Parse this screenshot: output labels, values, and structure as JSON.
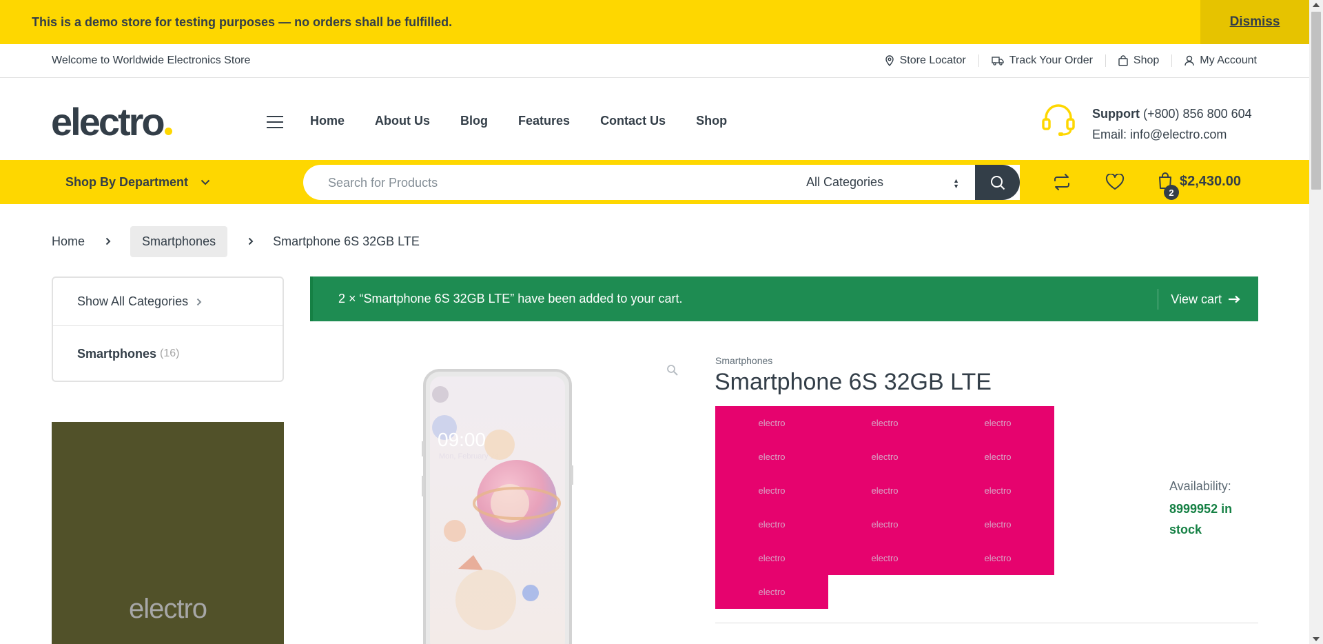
{
  "notice": {
    "text": "This is a demo store for testing purposes — no orders shall be fulfilled.",
    "dismiss_label": "Dismiss"
  },
  "topbar": {
    "welcome": "Welcome to Worldwide Electronics Store",
    "links": [
      {
        "label": "Store Locator",
        "icon": "map-pin-icon"
      },
      {
        "label": "Track Your Order",
        "icon": "truck-icon"
      },
      {
        "label": "Shop",
        "icon": "shopping-bag-icon"
      },
      {
        "label": "My Account",
        "icon": "user-icon"
      }
    ]
  },
  "header": {
    "logo": "electro",
    "nav": [
      "Home",
      "About Us",
      "Blog",
      "Features",
      "Contact Us",
      "Shop"
    ],
    "support_label": "Support",
    "support_phone": "(+800) 856 800 604",
    "support_email": "Email: info@electro.com"
  },
  "navbar": {
    "shop_by_department": "Shop By Department",
    "search_placeholder": "Search for Products",
    "category_selected": "All Categories",
    "cart_total": "$2,430.00",
    "cart_count": "2"
  },
  "breadcrumb": {
    "home": "Home",
    "category": "Smartphones",
    "current": "Smartphone 6S 32GB LTE"
  },
  "sidebar": {
    "show_all": "Show All Categories",
    "category_name": "Smartphones",
    "category_count": "(16)",
    "promo_text": "electro"
  },
  "cart_message": {
    "text": "2 × “Smartphone 6S 32GB LTE” have been added to your cart.",
    "view_cart": "View cart"
  },
  "product": {
    "category": "Smartphones",
    "title": "Smartphone 6S 32GB LTE",
    "brand_tile_text": "electro",
    "brand_tile_count": 16,
    "availability_label": "Availability:",
    "availability_value": "8999952 in stock",
    "phone_time": "09:00",
    "phone_date": "Mon, February 24"
  },
  "colors": {
    "accent_yellow": "#fed700",
    "dark": "#333e48",
    "success_green": "#1e8c52",
    "brand_tile_pink": "#e6036e",
    "promo_olive": "#515129"
  }
}
